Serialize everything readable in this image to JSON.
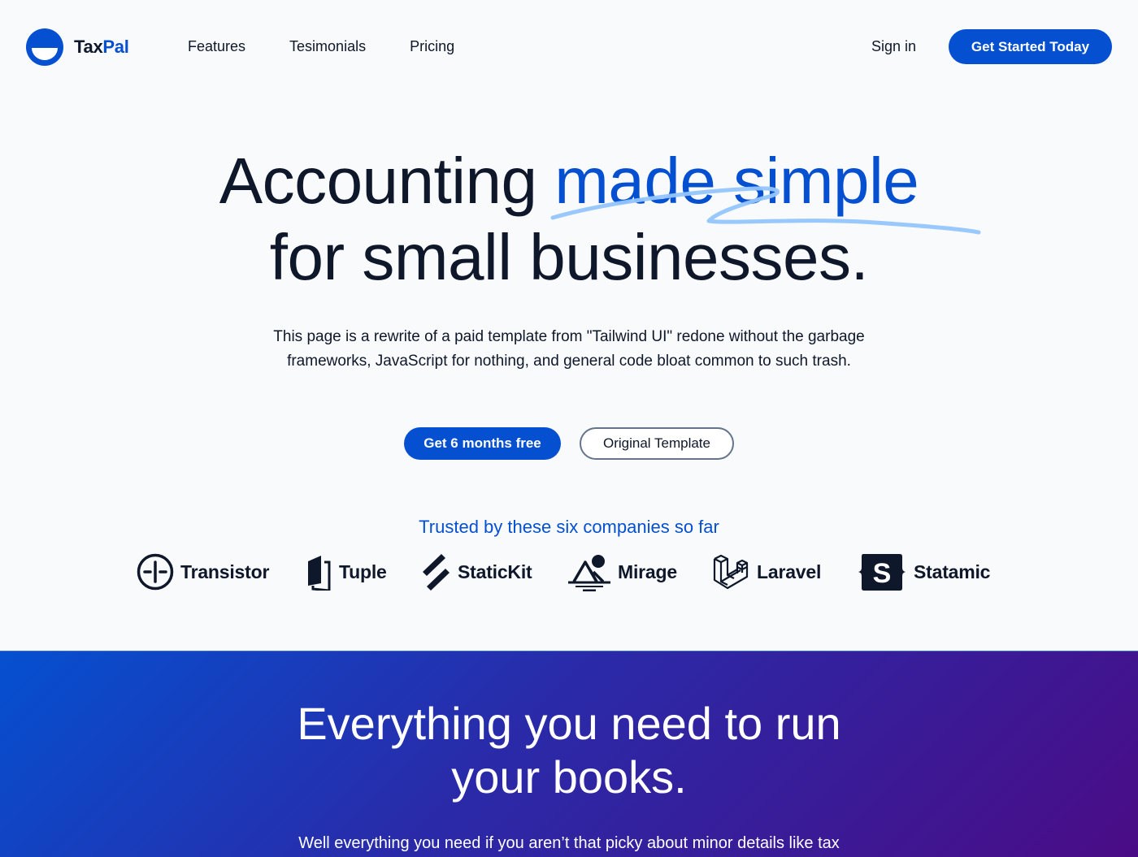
{
  "header": {
    "logo": {
      "prefix": "Tax",
      "suffix": "Pal",
      "icon": "half-circle-logo-icon"
    },
    "nav": [
      {
        "label": "Features"
      },
      {
        "label": "Tesimonials"
      },
      {
        "label": "Pricing"
      }
    ],
    "sign_in": "Sign in",
    "cta": "Get Started Today"
  },
  "hero": {
    "title_part1": "Accounting",
    "title_highlight": "made simple",
    "title_part2": "for small businesses.",
    "description": "This page is a rewrite of a paid template from \"Tailwind UI\" redone without the garbage frameworks, JavaScript for nothing, and general code bloat common to such trash.",
    "primary_button": "Get 6 months free",
    "secondary_button": "Original Template"
  },
  "trusted": {
    "heading": "Trusted by these six companies so far",
    "companies": [
      {
        "name": "Transistor",
        "icon": "transistor-icon"
      },
      {
        "name": "Tuple",
        "icon": "tuple-icon"
      },
      {
        "name": "StaticKit",
        "icon": "statickit-icon"
      },
      {
        "name": "Mirage",
        "icon": "mirage-icon"
      },
      {
        "name": "Laravel",
        "icon": "laravel-icon"
      },
      {
        "name": "Statamic",
        "icon": "statamic-icon"
      }
    ]
  },
  "features": {
    "title_line1": "Everything you need to run",
    "title_line2": "your books.",
    "subtitle": "Well everything you need if you aren’t that picky about minor details like tax"
  },
  "colors": {
    "brand": "#0550d0",
    "text": "#0f172a",
    "background": "#f8fafc",
    "scribble": "#93c5fd",
    "gradient_start": "#0550d0",
    "gradient_end": "#4a0c86"
  }
}
